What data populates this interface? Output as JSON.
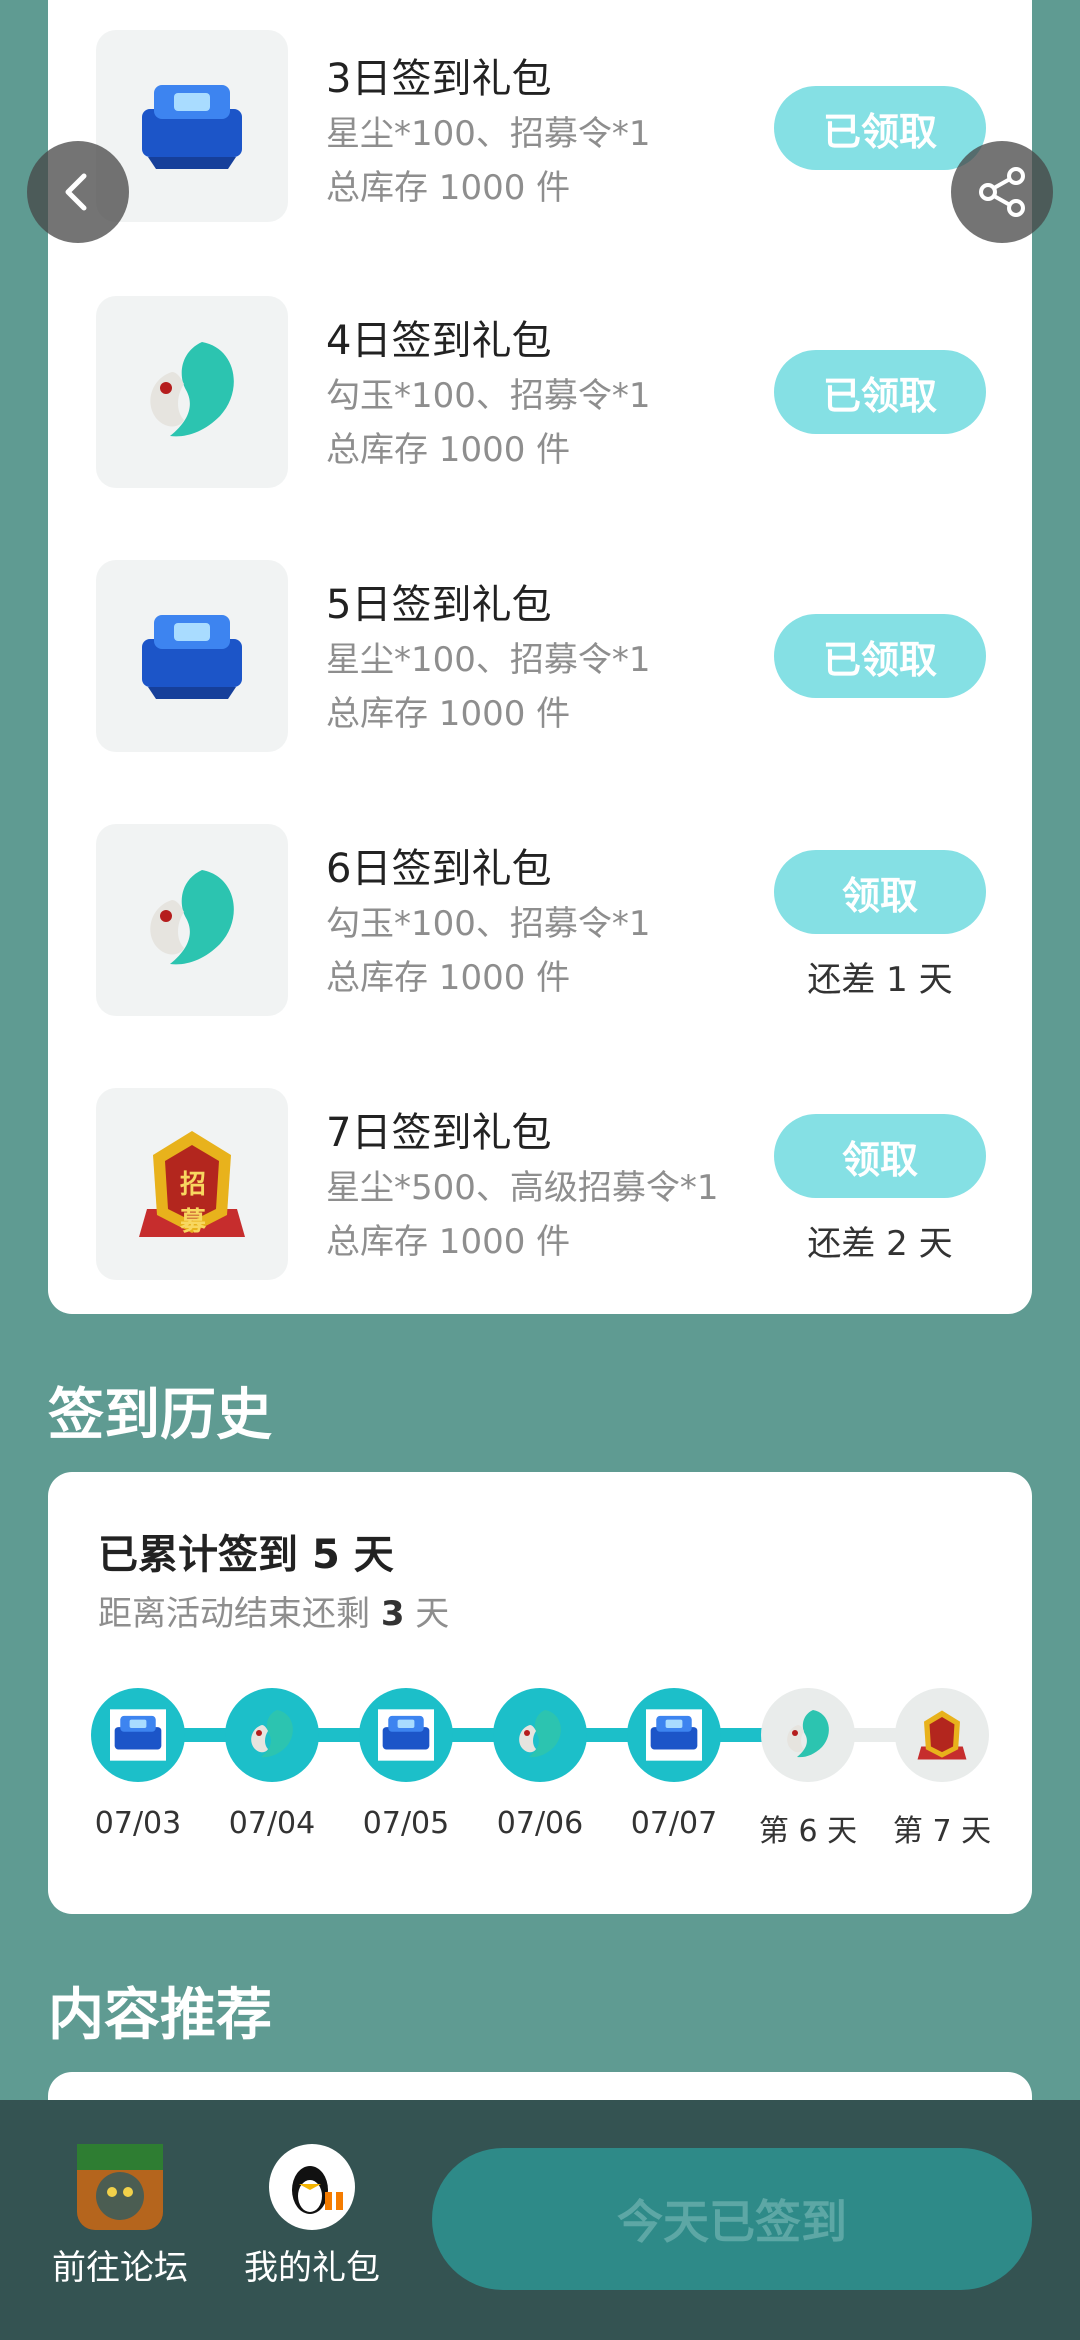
{
  "rewards": [
    {
      "title": "3日签到礼包",
      "desc": "星尘*100、招募令*1",
      "stock": "总库存 1000 件",
      "button": "已领取",
      "note": "",
      "icon": "star-dust-chest-icon"
    },
    {
      "title": "4日签到礼包",
      "desc": "勾玉*100、招募令*1",
      "stock": "总库存 1000 件",
      "button": "已领取",
      "note": "",
      "icon": "magatama-icon"
    },
    {
      "title": "5日签到礼包",
      "desc": "星尘*100、招募令*1",
      "stock": "总库存 1000 件",
      "button": "已领取",
      "note": "",
      "icon": "star-dust-chest-icon"
    },
    {
      "title": "6日签到礼包",
      "desc": "勾玉*100、招募令*1",
      "stock": "总库存 1000 件",
      "button": "领取",
      "note": "还差 1 天",
      "icon": "magatama-icon"
    },
    {
      "title": "7日签到礼包",
      "desc": "星尘*500、高级招募令*1",
      "stock": "总库存 1000 件",
      "button": "领取",
      "note": "还差 2 天",
      "icon": "recruit-badge-icon",
      "badge_text": "招募"
    }
  ],
  "history": {
    "title": "签到历史",
    "total_prefix": "已累计签到 ",
    "total_days": "5",
    "total_suffix": " 天",
    "remain_prefix": "距离活动结束还剩 ",
    "remain_days": "3",
    "remain_suffix": " 天",
    "days": [
      {
        "label": "07/03",
        "done": true,
        "icon": "star-dust-chest-icon"
      },
      {
        "label": "07/04",
        "done": true,
        "icon": "magatama-icon"
      },
      {
        "label": "07/05",
        "done": true,
        "icon": "star-dust-chest-icon"
      },
      {
        "label": "07/06",
        "done": true,
        "icon": "magatama-icon"
      },
      {
        "label": "07/07",
        "done": true,
        "icon": "star-dust-chest-icon"
      },
      {
        "label": "第 6 天",
        "done": false,
        "icon": "magatama-icon"
      },
      {
        "label": "第 7 天",
        "done": false,
        "icon": "recruit-badge-icon"
      }
    ]
  },
  "recommend": {
    "title": "内容推荐"
  },
  "bottom": {
    "forum_label": "前往论坛",
    "gift_label": "我的礼包",
    "sign_label": "今天已签到"
  },
  "colors": {
    "accent": "#1cbfc9",
    "button_light": "#85e0e4",
    "bg": "#5f9b92",
    "bar": "#345352"
  }
}
